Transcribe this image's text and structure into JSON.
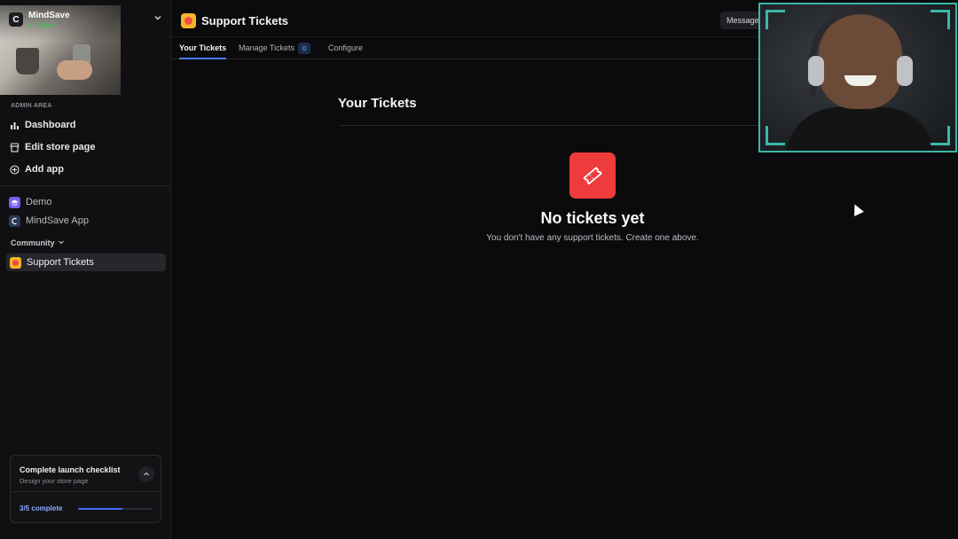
{
  "workspace": {
    "name": "MindSave",
    "status": "● Online",
    "logo_glyph": "C"
  },
  "sidebar": {
    "section_label": "ADMIN AREA",
    "admin_items": [
      {
        "label": "Dashboard",
        "icon": "chart-bar-icon"
      },
      {
        "label": "Edit store page",
        "icon": "store-icon"
      },
      {
        "label": "Add app",
        "icon": "plus-circle-icon"
      }
    ],
    "apps": [
      {
        "label": "Demo",
        "icon": "graduation-cap-icon",
        "color": "#7c5cf0"
      },
      {
        "label": "MindSave App",
        "icon": "mindsave-logo-icon",
        "color": "#2b3a55"
      }
    ],
    "community_label": "Community",
    "active_app": {
      "label": "Support Tickets"
    }
  },
  "checklist": {
    "title": "Complete launch checklist",
    "subtitle": "Design your store page",
    "progress_label": "3/5 complete",
    "progress_fraction": 0.6
  },
  "header": {
    "title": "Support Tickets",
    "message_button": "Message"
  },
  "tabs": [
    {
      "label": "Your Tickets",
      "active": true
    },
    {
      "label": "Manage Tickets",
      "count": "0"
    },
    {
      "label": "Configure"
    }
  ],
  "main": {
    "title": "Your Tickets",
    "empty_title": "No tickets yet",
    "empty_subtitle": "You don't have any support tickets. Create one above.",
    "empty_icon": "ticket-icon"
  },
  "colors": {
    "accent": "#4a7cf7",
    "empty_icon_bg": "#ee3b3b",
    "webcam_border": "#3bb7aa"
  }
}
